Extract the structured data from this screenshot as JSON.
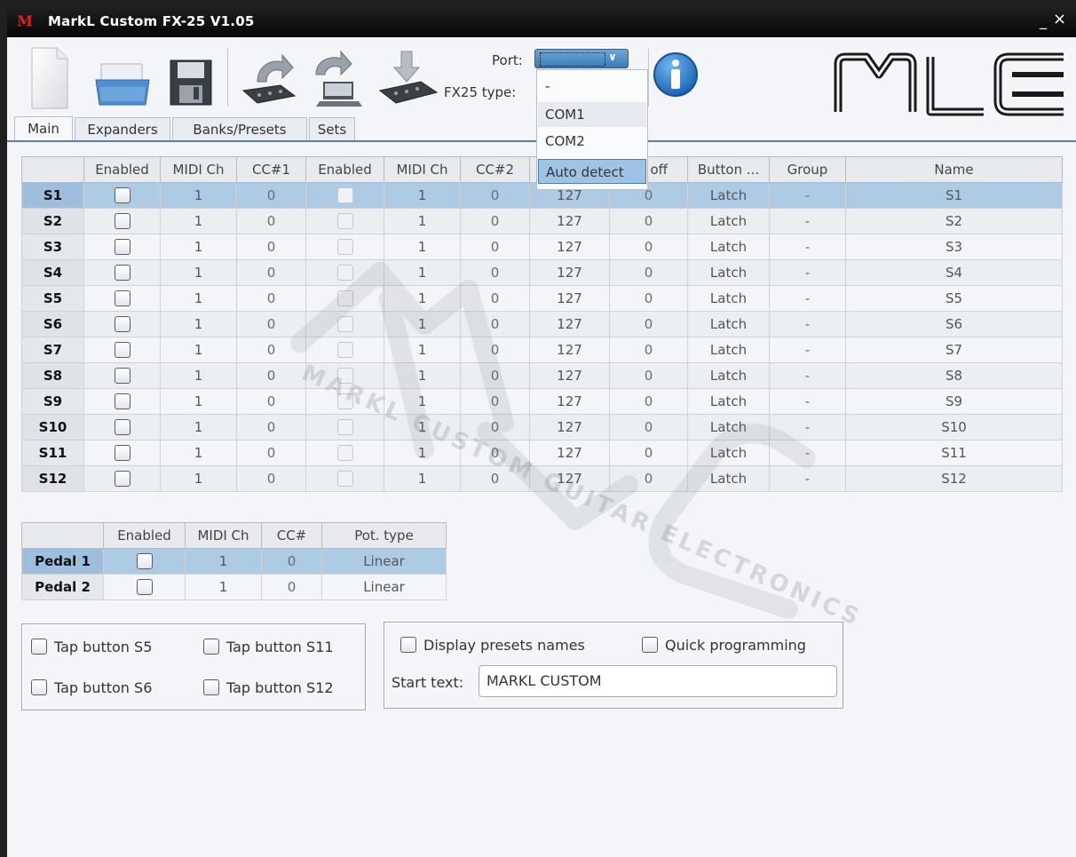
{
  "window": {
    "title": "MarkL Custom FX-25 V1.05",
    "app_icon_letter": "M",
    "minimize_glyph": "_",
    "close_glyph": "×"
  },
  "toolbar": {
    "port_label": "Port:",
    "port_value": "-",
    "fx25_type_label": "FX25 type:",
    "port_options": [
      "-",
      "COM1",
      "COM2",
      "Auto detect"
    ],
    "port_highlighted": "Auto detect",
    "icons": [
      "new-document-icon",
      "open-folder-icon",
      "save-disk-icon",
      "upload-device-icon",
      "download-device-icon",
      "flash-device-icon",
      "info-icon"
    ]
  },
  "logo": {
    "text": "MLC"
  },
  "tabs": [
    "Main",
    "Expanders",
    "Banks/Presets",
    "Sets"
  ],
  "active_tab": "Main",
  "switch_table": {
    "columns": [
      "",
      "Enabled",
      "MIDI Ch",
      "CC#1",
      "Enabled",
      "MIDI Ch",
      "CC#2",
      "...",
      "ue off",
      "Button ...",
      "Group",
      "Name"
    ],
    "rows": [
      {
        "id": "S1",
        "ch1": "1",
        "cc1": "0",
        "ch2": "1",
        "cc2": "0",
        "on": "127",
        "off": "0",
        "mode": "Latch",
        "group": "-",
        "name": "S1"
      },
      {
        "id": "S2",
        "ch1": "1",
        "cc1": "0",
        "ch2": "1",
        "cc2": "0",
        "on": "127",
        "off": "0",
        "mode": "Latch",
        "group": "-",
        "name": "S2"
      },
      {
        "id": "S3",
        "ch1": "1",
        "cc1": "0",
        "ch2": "1",
        "cc2": "0",
        "on": "127",
        "off": "0",
        "mode": "Latch",
        "group": "-",
        "name": "S3"
      },
      {
        "id": "S4",
        "ch1": "1",
        "cc1": "0",
        "ch2": "1",
        "cc2": "0",
        "on": "127",
        "off": "0",
        "mode": "Latch",
        "group": "-",
        "name": "S4"
      },
      {
        "id": "S5",
        "ch1": "1",
        "cc1": "0",
        "ch2": "1",
        "cc2": "0",
        "on": "127",
        "off": "0",
        "mode": "Latch",
        "group": "-",
        "name": "S5"
      },
      {
        "id": "S6",
        "ch1": "1",
        "cc1": "0",
        "ch2": "1",
        "cc2": "0",
        "on": "127",
        "off": "0",
        "mode": "Latch",
        "group": "-",
        "name": "S6"
      },
      {
        "id": "S7",
        "ch1": "1",
        "cc1": "0",
        "ch2": "1",
        "cc2": "0",
        "on": "127",
        "off": "0",
        "mode": "Latch",
        "group": "-",
        "name": "S7"
      },
      {
        "id": "S8",
        "ch1": "1",
        "cc1": "0",
        "ch2": "1",
        "cc2": "0",
        "on": "127",
        "off": "0",
        "mode": "Latch",
        "group": "-",
        "name": "S8"
      },
      {
        "id": "S9",
        "ch1": "1",
        "cc1": "0",
        "ch2": "1",
        "cc2": "0",
        "on": "127",
        "off": "0",
        "mode": "Latch",
        "group": "-",
        "name": "S9"
      },
      {
        "id": "S10",
        "ch1": "1",
        "cc1": "0",
        "ch2": "1",
        "cc2": "0",
        "on": "127",
        "off": "0",
        "mode": "Latch",
        "group": "-",
        "name": "S10"
      },
      {
        "id": "S11",
        "ch1": "1",
        "cc1": "0",
        "ch2": "1",
        "cc2": "0",
        "on": "127",
        "off": "0",
        "mode": "Latch",
        "group": "-",
        "name": "S11"
      },
      {
        "id": "S12",
        "ch1": "1",
        "cc1": "0",
        "ch2": "1",
        "cc2": "0",
        "on": "127",
        "off": "0",
        "mode": "Latch",
        "group": "-",
        "name": "S12"
      }
    ]
  },
  "pedal_table": {
    "columns": [
      "",
      "Enabled",
      "MIDI Ch",
      "CC#",
      "Pot. type"
    ],
    "rows": [
      {
        "id": "Pedal 1",
        "ch": "1",
        "cc": "0",
        "type": "Linear"
      },
      {
        "id": "Pedal 2",
        "ch": "1",
        "cc": "0",
        "type": "Linear"
      }
    ]
  },
  "tap_buttons": [
    "Tap button S5",
    "Tap button S11",
    "Tap button S6",
    "Tap button S12"
  ],
  "display": {
    "presets_names_label": "Display presets names",
    "quick_programming_label": "Quick programming",
    "start_text_label": "Start text:",
    "start_text_value": "MARKL CUSTOM"
  },
  "watermark_text": "MARKL CUSTOM GUITAR ELECTRONICS",
  "colors": {
    "selection": "#aecbe5",
    "accent": "#3b7ab7",
    "titlebar": "#111111",
    "brand_red": "#e02020"
  }
}
